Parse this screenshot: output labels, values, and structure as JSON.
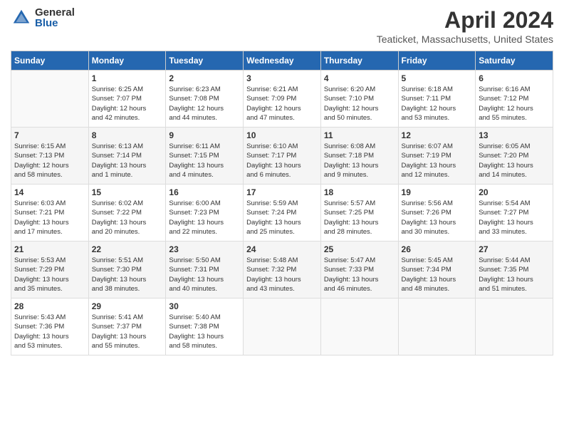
{
  "header": {
    "logo_general": "General",
    "logo_blue": "Blue",
    "month_title": "April 2024",
    "location": "Teaticket, Massachusetts, United States"
  },
  "weekdays": [
    "Sunday",
    "Monday",
    "Tuesday",
    "Wednesday",
    "Thursday",
    "Friday",
    "Saturday"
  ],
  "weeks": [
    [
      {
        "day": "",
        "info": ""
      },
      {
        "day": "1",
        "info": "Sunrise: 6:25 AM\nSunset: 7:07 PM\nDaylight: 12 hours\nand 42 minutes."
      },
      {
        "day": "2",
        "info": "Sunrise: 6:23 AM\nSunset: 7:08 PM\nDaylight: 12 hours\nand 44 minutes."
      },
      {
        "day": "3",
        "info": "Sunrise: 6:21 AM\nSunset: 7:09 PM\nDaylight: 12 hours\nand 47 minutes."
      },
      {
        "day": "4",
        "info": "Sunrise: 6:20 AM\nSunset: 7:10 PM\nDaylight: 12 hours\nand 50 minutes."
      },
      {
        "day": "5",
        "info": "Sunrise: 6:18 AM\nSunset: 7:11 PM\nDaylight: 12 hours\nand 53 minutes."
      },
      {
        "day": "6",
        "info": "Sunrise: 6:16 AM\nSunset: 7:12 PM\nDaylight: 12 hours\nand 55 minutes."
      }
    ],
    [
      {
        "day": "7",
        "info": "Sunrise: 6:15 AM\nSunset: 7:13 PM\nDaylight: 12 hours\nand 58 minutes."
      },
      {
        "day": "8",
        "info": "Sunrise: 6:13 AM\nSunset: 7:14 PM\nDaylight: 13 hours\nand 1 minute."
      },
      {
        "day": "9",
        "info": "Sunrise: 6:11 AM\nSunset: 7:15 PM\nDaylight: 13 hours\nand 4 minutes."
      },
      {
        "day": "10",
        "info": "Sunrise: 6:10 AM\nSunset: 7:17 PM\nDaylight: 13 hours\nand 6 minutes."
      },
      {
        "day": "11",
        "info": "Sunrise: 6:08 AM\nSunset: 7:18 PM\nDaylight: 13 hours\nand 9 minutes."
      },
      {
        "day": "12",
        "info": "Sunrise: 6:07 AM\nSunset: 7:19 PM\nDaylight: 13 hours\nand 12 minutes."
      },
      {
        "day": "13",
        "info": "Sunrise: 6:05 AM\nSunset: 7:20 PM\nDaylight: 13 hours\nand 14 minutes."
      }
    ],
    [
      {
        "day": "14",
        "info": "Sunrise: 6:03 AM\nSunset: 7:21 PM\nDaylight: 13 hours\nand 17 minutes."
      },
      {
        "day": "15",
        "info": "Sunrise: 6:02 AM\nSunset: 7:22 PM\nDaylight: 13 hours\nand 20 minutes."
      },
      {
        "day": "16",
        "info": "Sunrise: 6:00 AM\nSunset: 7:23 PM\nDaylight: 13 hours\nand 22 minutes."
      },
      {
        "day": "17",
        "info": "Sunrise: 5:59 AM\nSunset: 7:24 PM\nDaylight: 13 hours\nand 25 minutes."
      },
      {
        "day": "18",
        "info": "Sunrise: 5:57 AM\nSunset: 7:25 PM\nDaylight: 13 hours\nand 28 minutes."
      },
      {
        "day": "19",
        "info": "Sunrise: 5:56 AM\nSunset: 7:26 PM\nDaylight: 13 hours\nand 30 minutes."
      },
      {
        "day": "20",
        "info": "Sunrise: 5:54 AM\nSunset: 7:27 PM\nDaylight: 13 hours\nand 33 minutes."
      }
    ],
    [
      {
        "day": "21",
        "info": "Sunrise: 5:53 AM\nSunset: 7:29 PM\nDaylight: 13 hours\nand 35 minutes."
      },
      {
        "day": "22",
        "info": "Sunrise: 5:51 AM\nSunset: 7:30 PM\nDaylight: 13 hours\nand 38 minutes."
      },
      {
        "day": "23",
        "info": "Sunrise: 5:50 AM\nSunset: 7:31 PM\nDaylight: 13 hours\nand 40 minutes."
      },
      {
        "day": "24",
        "info": "Sunrise: 5:48 AM\nSunset: 7:32 PM\nDaylight: 13 hours\nand 43 minutes."
      },
      {
        "day": "25",
        "info": "Sunrise: 5:47 AM\nSunset: 7:33 PM\nDaylight: 13 hours\nand 46 minutes."
      },
      {
        "day": "26",
        "info": "Sunrise: 5:45 AM\nSunset: 7:34 PM\nDaylight: 13 hours\nand 48 minutes."
      },
      {
        "day": "27",
        "info": "Sunrise: 5:44 AM\nSunset: 7:35 PM\nDaylight: 13 hours\nand 51 minutes."
      }
    ],
    [
      {
        "day": "28",
        "info": "Sunrise: 5:43 AM\nSunset: 7:36 PM\nDaylight: 13 hours\nand 53 minutes."
      },
      {
        "day": "29",
        "info": "Sunrise: 5:41 AM\nSunset: 7:37 PM\nDaylight: 13 hours\nand 55 minutes."
      },
      {
        "day": "30",
        "info": "Sunrise: 5:40 AM\nSunset: 7:38 PM\nDaylight: 13 hours\nand 58 minutes."
      },
      {
        "day": "",
        "info": ""
      },
      {
        "day": "",
        "info": ""
      },
      {
        "day": "",
        "info": ""
      },
      {
        "day": "",
        "info": ""
      }
    ]
  ]
}
